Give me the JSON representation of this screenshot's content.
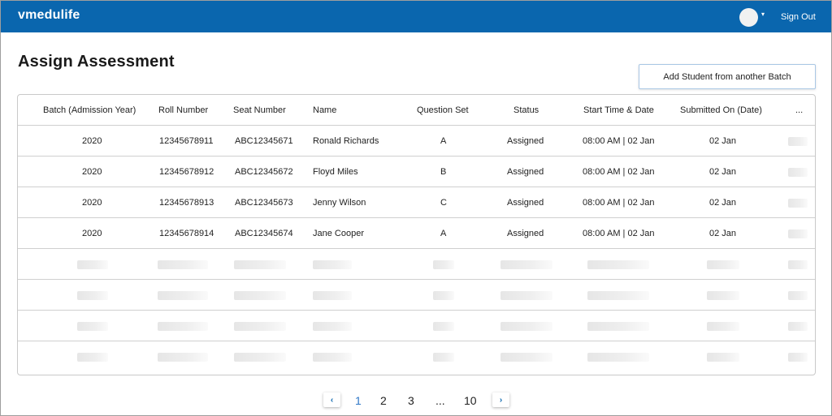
{
  "app": {
    "brand": "vmedulife",
    "sign_out": "Sign Out"
  },
  "page": {
    "title": "Assign Assessment",
    "add_button": "Add Student from another Batch"
  },
  "table": {
    "headers": [
      "Batch (Admission Year)",
      "Roll Number",
      "Seat Number",
      "Name",
      "Question Set",
      "Status",
      "Start Time & Date",
      "Submitted On (Date)",
      "..."
    ],
    "rows": [
      [
        "2020",
        "12345678911",
        "ABC12345671",
        "Ronald Richards",
        "A",
        "Assigned",
        "08:00 AM | 02 Jan",
        "02 Jan"
      ],
      [
        "2020",
        "12345678912",
        "ABC12345672",
        "Floyd Miles",
        "B",
        "Assigned",
        "08:00 AM | 02 Jan",
        "02 Jan"
      ],
      [
        "2020",
        "12345678913",
        "ABC12345673",
        "Jenny Wilson",
        "C",
        "Assigned",
        "08:00 AM | 02 Jan",
        "02 Jan"
      ],
      [
        "2020",
        "12345678914",
        "ABC12345674",
        "Jane Cooper",
        "A",
        "Assigned",
        "08:00 AM | 02 Jan",
        "02 Jan"
      ]
    ]
  },
  "pagination": {
    "prev_icon": "‹",
    "next_icon": "›",
    "pages": [
      "1",
      "2",
      "3",
      "...",
      "10"
    ],
    "current": "1"
  },
  "icons": {
    "caret": "▾",
    "avatar": "avatar-placeholder"
  },
  "colors": {
    "header": "#0a66ae",
    "active_page": "#2f77c7"
  }
}
